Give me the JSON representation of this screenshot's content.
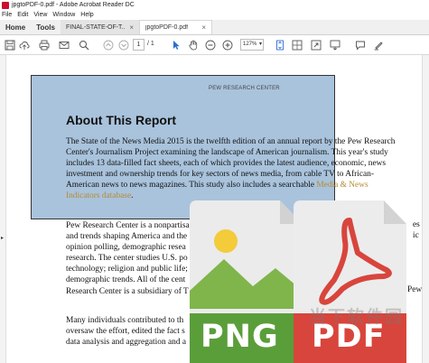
{
  "window": {
    "title": "jpgtoPDF-0.pdf - Adobe Acrobat Reader DC"
  },
  "menu": {
    "items": [
      "File",
      "Edit",
      "View",
      "Window",
      "Help"
    ]
  },
  "tabs": {
    "nav": [
      "Home",
      "Tools"
    ],
    "documents": [
      {
        "label": "FINAL-STATE-OF-T...",
        "close": "×"
      },
      {
        "label": "jpgtoPDF-0.pdf",
        "close": "×"
      }
    ]
  },
  "toolbar": {
    "page_current": "1",
    "page_total": "/ 1",
    "zoom": "127%",
    "zoom_caret": "▾"
  },
  "document": {
    "page_number": "1",
    "header": "PEW RESEARCH CENTER",
    "box_title": "About This Report",
    "box_lines": [
      "The State of the News Media 2015 is the twelfth edition of an annual report by the Pew Research",
      "Center's Journalism Project examining the landscape of American journalism. This year's study",
      "includes 13 data-filled fact sheets, each of which provides the latest audience, economic, news",
      "investment and ownership trends for key sectors of news media, from cable TV to African-",
      "American news to news magazines. This study also includes a searchable "
    ],
    "box_link_1": "Media & News",
    "box_link_2": "Indicators database",
    "box_period": ".",
    "body_lines": [
      "Pew Research Center is a nonpartisan",
      "and trends shaping America and the",
      "opinion polling, demographic resea",
      "research. The center studies U.S. po",
      "technology; religion and public life;",
      "demographic trends. All of the cent",
      "Research Center is a subsidiary of T"
    ],
    "body_right_fragments": [
      "es",
      "ic",
      "Pew"
    ],
    "body2_lines": [
      "Many individuals contributed to th",
      "oversaw the effort, edited the fact s",
      "data analysis and aggregation and a"
    ]
  },
  "overlay": {
    "png_label": "PNG",
    "pdf_label": "PDF",
    "watermark": "当下软件园"
  },
  "colors": {
    "png_green": "#5a9e3a",
    "pdf_red": "#d8453c",
    "box_blue": "#a9c3dc",
    "acrobat_red": "#c8102e"
  }
}
